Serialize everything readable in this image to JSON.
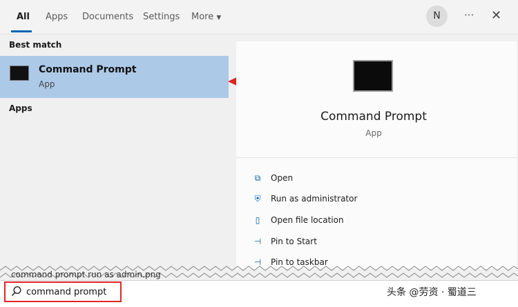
{
  "tabs": [
    "All",
    "Apps",
    "Documents",
    "Settings",
    "More"
  ],
  "user_initial": "N",
  "more_menu_icon": "ellipsis-icon",
  "left": {
    "section_best": "Best match",
    "best_item": {
      "title": "Command Prompt",
      "subtitle": "App"
    },
    "section_apps": "Apps",
    "partial_result": "command prompt run as admin.png"
  },
  "details": {
    "title": "Command Prompt",
    "subtitle": "App",
    "actions": [
      "Open",
      "Run as administrator",
      "Open file location",
      "Pin to Start",
      "Pin to taskbar"
    ]
  },
  "search": {
    "value": "command prompt"
  },
  "watermark": "头条 @劳资 · 蜀道三",
  "colors": {
    "accent": "#0063b1",
    "highlight": "#acc9e8",
    "arrow": "#e02424"
  }
}
